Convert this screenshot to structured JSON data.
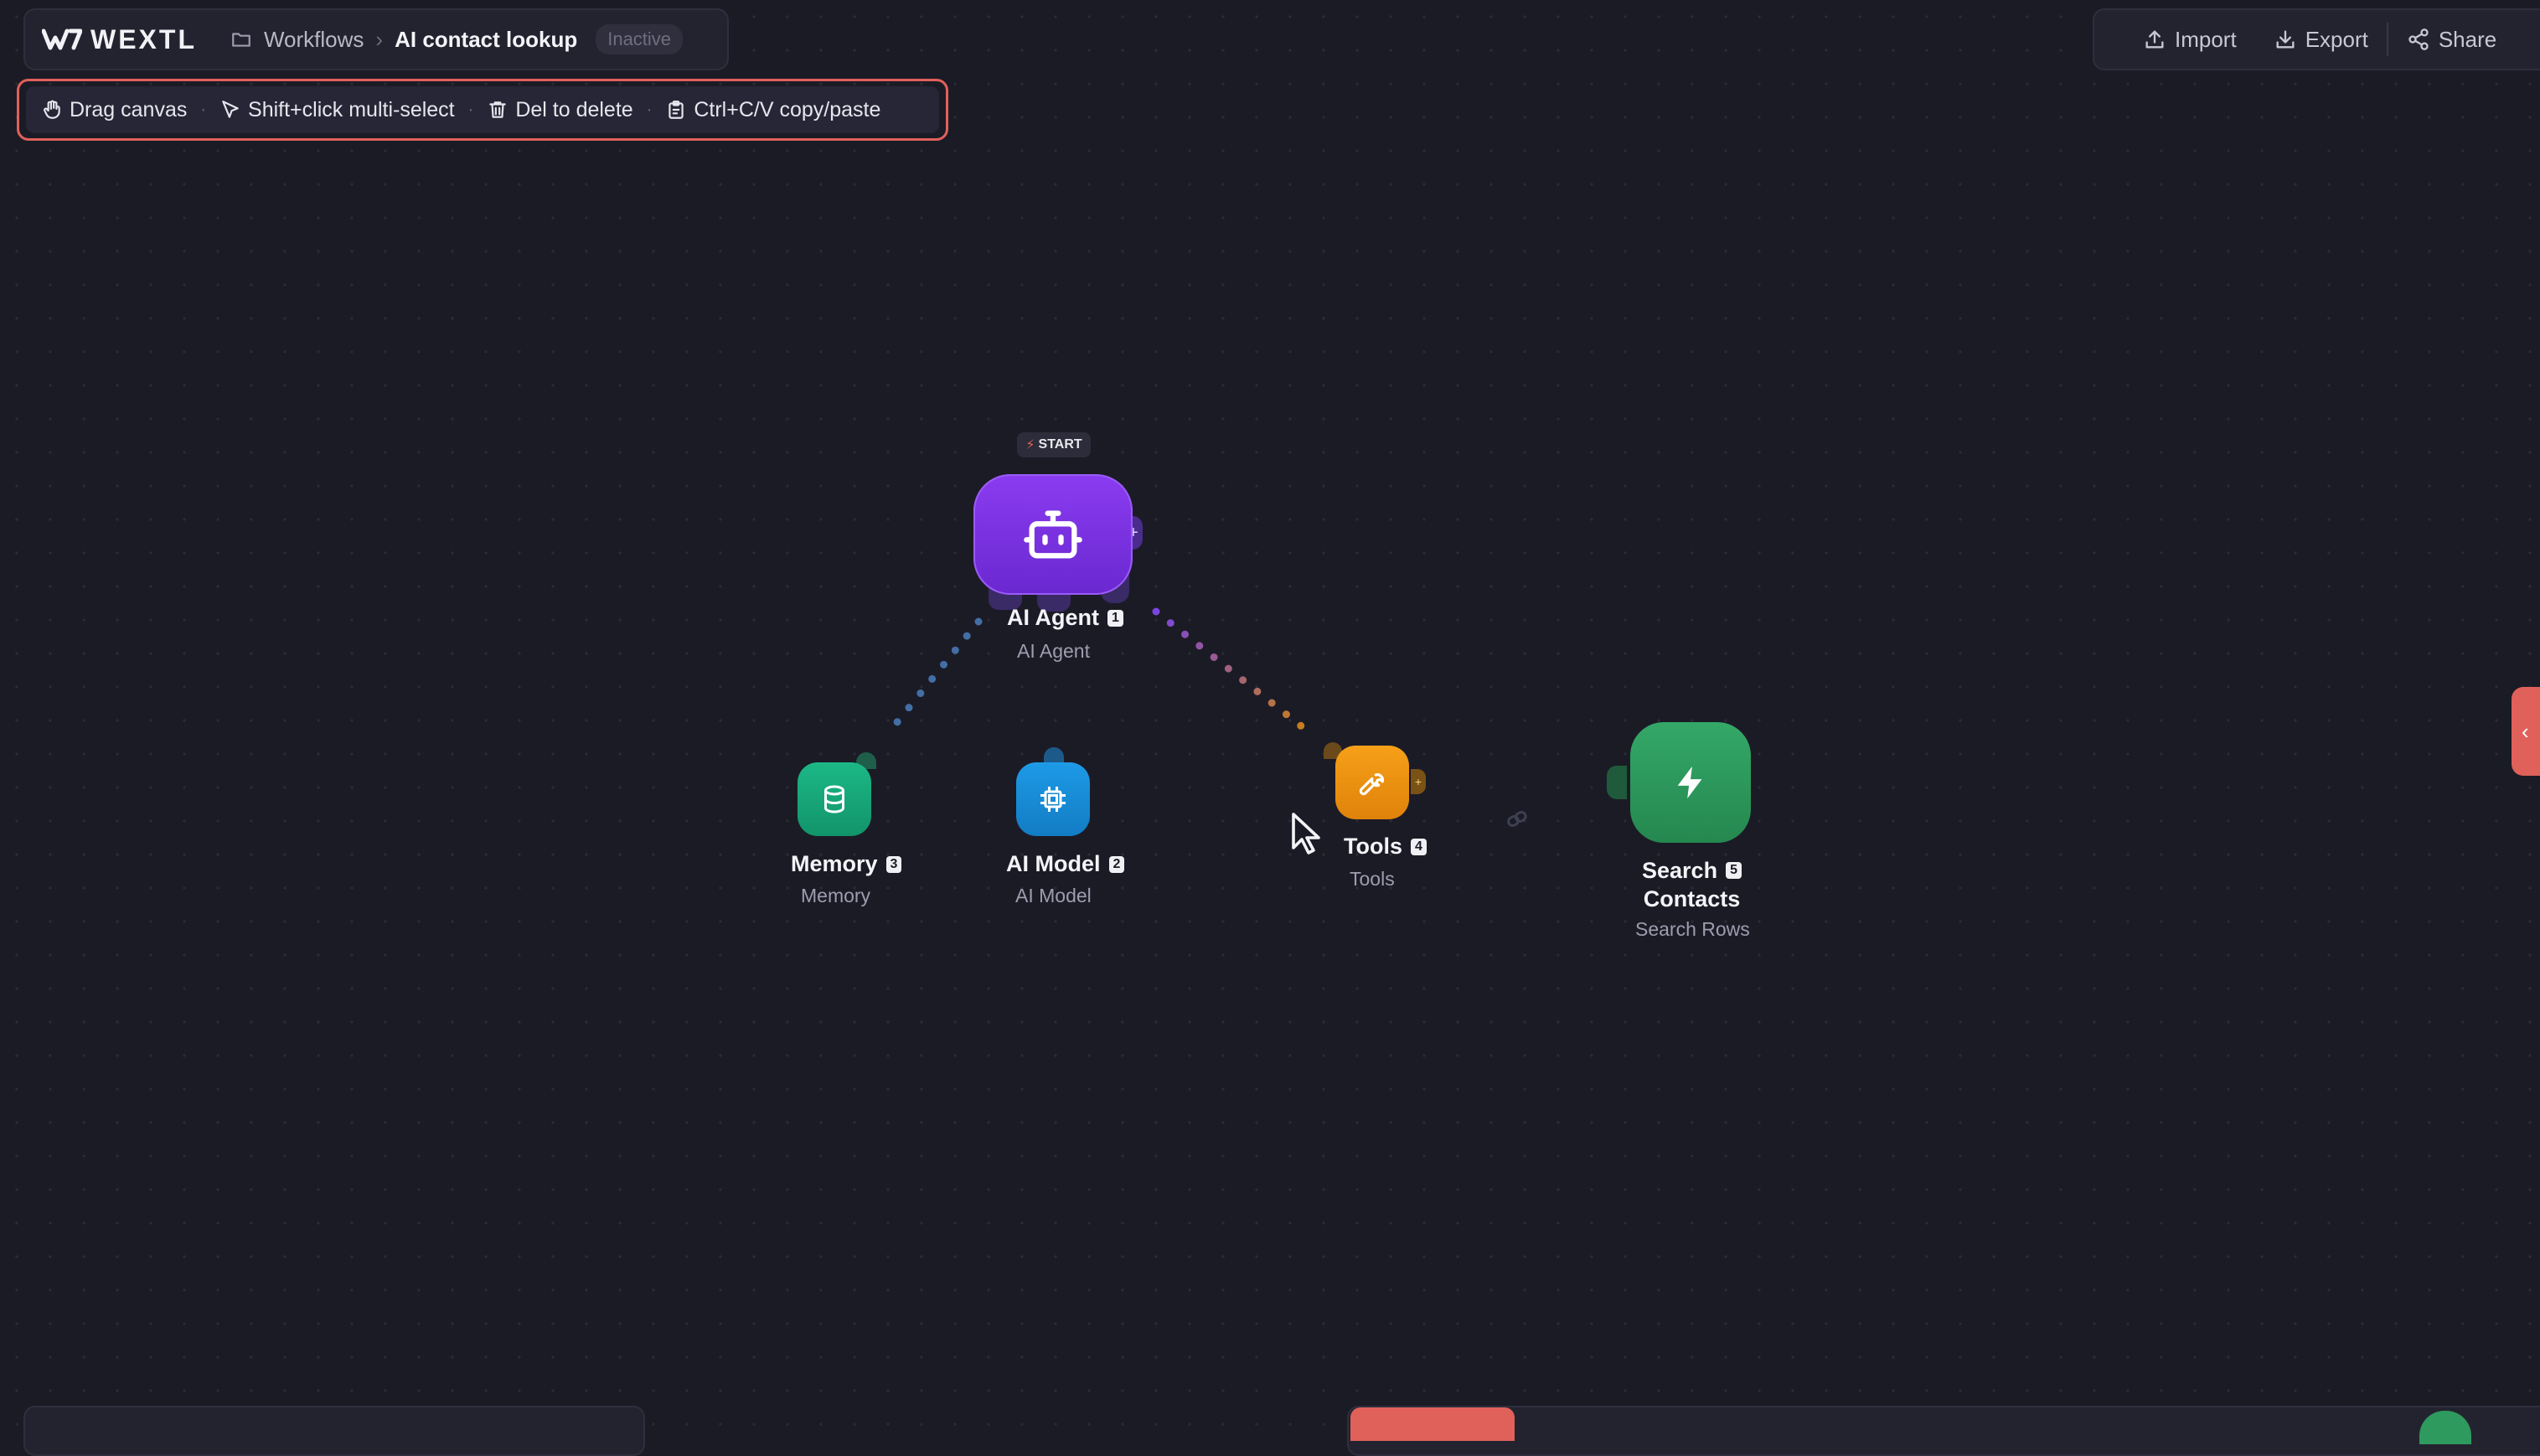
{
  "app": {
    "logo_text": "WEXTL",
    "breadcrumb_root": "Workflows",
    "breadcrumb_sep": "›",
    "workflow_name": "AI contact lookup",
    "status": "Inactive"
  },
  "toolbar": {
    "import_label": "Import",
    "export_label": "Export",
    "share_label": "Share"
  },
  "hints": [
    {
      "label": "Drag canvas",
      "icon": "hand-icon"
    },
    {
      "label": "Shift+click multi-select",
      "icon": "pointer-icon"
    },
    {
      "label": "Del to delete",
      "icon": "trash-icon"
    },
    {
      "label": "Ctrl+C/V copy/paste",
      "icon": "clipboard-icon"
    }
  ],
  "start_tag": "START",
  "nodes": {
    "agent": {
      "title": "AI Agent",
      "num": "1",
      "subtitle": "AI Agent",
      "color": "#7a34e0",
      "icon": "robot-icon"
    },
    "memory": {
      "title": "Memory",
      "num": "3",
      "subtitle": "Memory",
      "color": "#17a878",
      "icon": "database-icon"
    },
    "model": {
      "title": "AI Model",
      "num": "2",
      "subtitle": "AI Model",
      "color": "#1a8fd8",
      "icon": "chip-icon"
    },
    "tools": {
      "title": "Tools",
      "num": "4",
      "subtitle": "Tools",
      "color": "#f0920e",
      "icon": "wrench-icon"
    },
    "search": {
      "title_line1": "Search",
      "title_line2": "Contacts",
      "num": "5",
      "subtitle": "Search Rows",
      "color": "#2e9a5e",
      "icon": "lightning-icon"
    }
  },
  "colors": {
    "accent_red": "#e0615a",
    "background": "#1b1b26",
    "panel": "#232330"
  },
  "side_tab_glyph": "‹"
}
